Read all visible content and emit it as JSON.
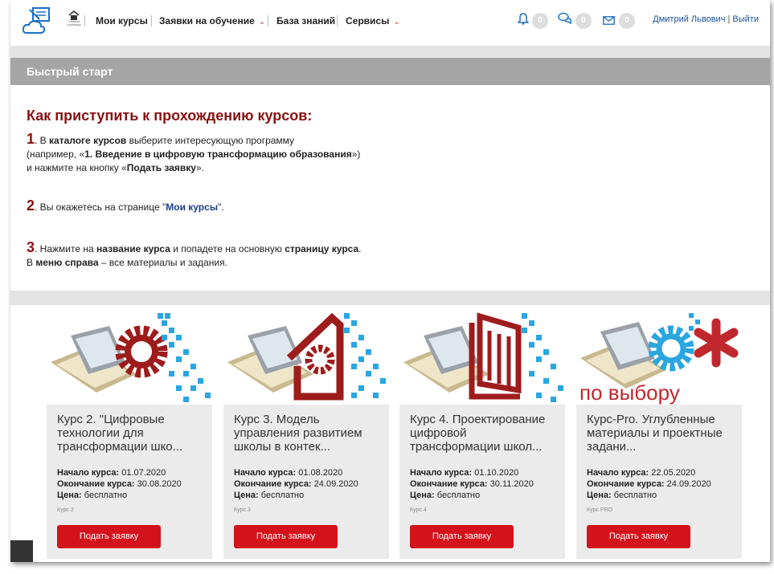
{
  "header": {
    "home_caption": "Главная страница",
    "nav": {
      "my_courses": "Мои курсы",
      "applications": "Заявки на обучение",
      "knowledge_base": "База знаний",
      "services": "Сервисы"
    },
    "counts": {
      "notifications": "0",
      "messages": "0",
      "mail": "0"
    },
    "user_name": "Дмитрий Львович",
    "separator": "|",
    "logout": "Выйти"
  },
  "quick_start": {
    "title": "Быстрый старт",
    "heading": "Как приступить к прохождению курсов:",
    "step1": {
      "num": "1",
      "t1": ". В ",
      "b1": "каталоге курсов",
      "t2": " выберите интересующую программу",
      "t3": "(например, «",
      "b2": "1. Введение в цифровую трансформацию образования",
      "t4": "»)",
      "t5": "и нажмите на кнопку «",
      "b3": "Подать заявку",
      "t6": "»."
    },
    "step2": {
      "num": "2",
      "t1": ". Вы окажетесь на странице \"",
      "b1": "Мои курсы",
      "t2": "\"."
    },
    "step3": {
      "num": "3",
      "t1": ". Нажмите на ",
      "b1": "название курса",
      "t2": " и попадете на основную ",
      "b2": "страницу курса",
      "t3": ".",
      "t4": "В ",
      "b3": "меню справа",
      "t5": " – все материалы и задания."
    }
  },
  "labels": {
    "start": "Начало курса:",
    "end": "Окончание курса:",
    "price": "Цена:"
  },
  "courses": [
    {
      "title": "Курс 2. \"Цифровые технологии для трансформации шко...",
      "start": "01.07.2020",
      "end": "30.08.2020",
      "price": "бесплатно",
      "code": "Курс 2",
      "button": "Подать заявку"
    },
    {
      "title": "Курс 3. Модель управления развитием школы в контек...",
      "start": "01.08.2020",
      "end": "24.09.2020",
      "price": "бесплатно",
      "code": "Курс 3",
      "button": "Подать заявку"
    },
    {
      "title": "Курс 4. Проектирование цифровой трансформации школ...",
      "start": "01.10.2020",
      "end": "30.11.2020",
      "price": "бесплатно",
      "code": "Курс 4",
      "button": "Подать заявку"
    },
    {
      "title": "Курс-Pro. Углубленные материалы и проектные задани...",
      "start": "22.05.2020",
      "end": "24.09.2020",
      "price": "бесплатно",
      "code": "Курс PRO",
      "button": "Подать заявку",
      "overlay": "по выбору"
    }
  ],
  "colors": {
    "accent": "#8a1111",
    "button": "#d4121b",
    "link": "#1a4f9c",
    "header_bar": "#a5a5a5",
    "pixel_blue": "#2aa6e0"
  }
}
